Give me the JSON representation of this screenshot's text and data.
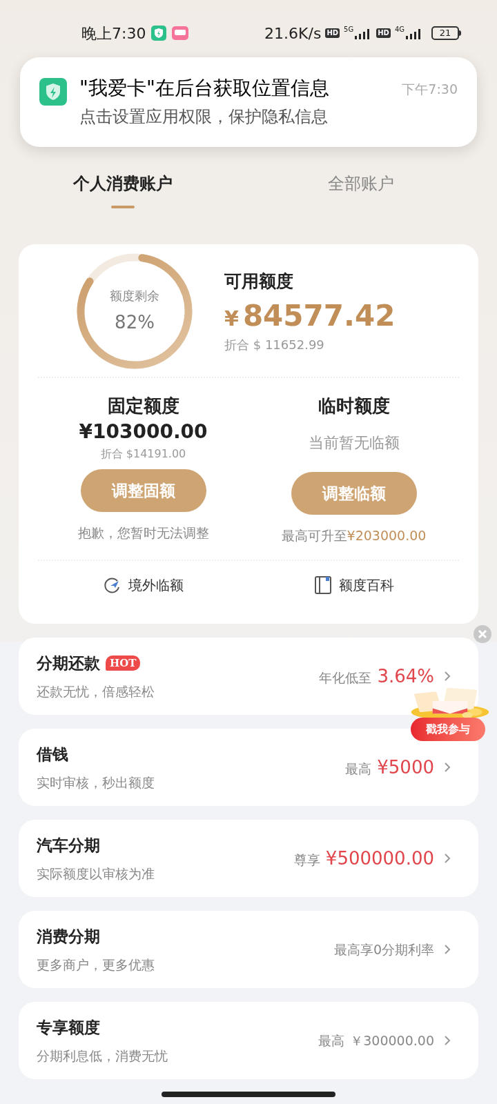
{
  "status_bar": {
    "time": "晚上7:30",
    "speed": "21.6K/s",
    "sims": [
      {
        "hd": "HD",
        "net": "5G"
      },
      {
        "hd": "HD",
        "net": "4G"
      }
    ],
    "battery": "21"
  },
  "notification": {
    "title": "\"我爱卡\"在后台获取位置信息",
    "body": "点击设置应用权限，保护隐私信息",
    "time": "下午7:30"
  },
  "tabs": [
    {
      "label": "个人消费账户",
      "selected": true
    },
    {
      "label": "全部账户",
      "selected": false
    }
  ],
  "credit": {
    "ring_label": "额度剩余",
    "ring_value": "82%",
    "level": 0.82,
    "available_label": "可用额度",
    "currency": "¥",
    "available": "84577.42",
    "converted": "折合 $ 11652.99",
    "columns": [
      {
        "title": "固定额度",
        "amount": "¥103000.00",
        "sub": "折合 $14191.00",
        "button": "调整固额",
        "note": "抱歉，您暂时无法调整"
      },
      {
        "title": "临时额度",
        "sub": "当前暂无临额",
        "button": "调整临额",
        "note": "最高可升至**¥203000.00**"
      }
    ],
    "links": [
      {
        "kind": "plane",
        "label": "境外临额"
      },
      {
        "kind": "book",
        "label": "额度百科"
      }
    ]
  },
  "rows": [
    {
      "title": "分期还款",
      "badge": "HOT",
      "subtitle": "还款无忧，倍感轻松",
      "prefix": "年化低至",
      "value": "3.64%",
      "highlight": true
    },
    {
      "title": "借钱",
      "subtitle": "实时审核，秒出额度",
      "prefix": "最高",
      "value": "¥5000",
      "highlight": true
    },
    {
      "title": "汽车分期",
      "subtitle": "实际额度以审核为准",
      "prefix": "尊享",
      "value": "¥500000.00",
      "highlight": true
    },
    {
      "title": "消费分期",
      "subtitle": "更多商户，更多优惠",
      "value": "最高享0分期利率",
      "highlight": false
    },
    {
      "title": "专享额度",
      "subtitle": "分期利息低，消费无忧",
      "prefix": "最高",
      "value": "￥300000.00",
      "highlight": false
    }
  ],
  "promo": {
    "button": "戳我参与"
  }
}
